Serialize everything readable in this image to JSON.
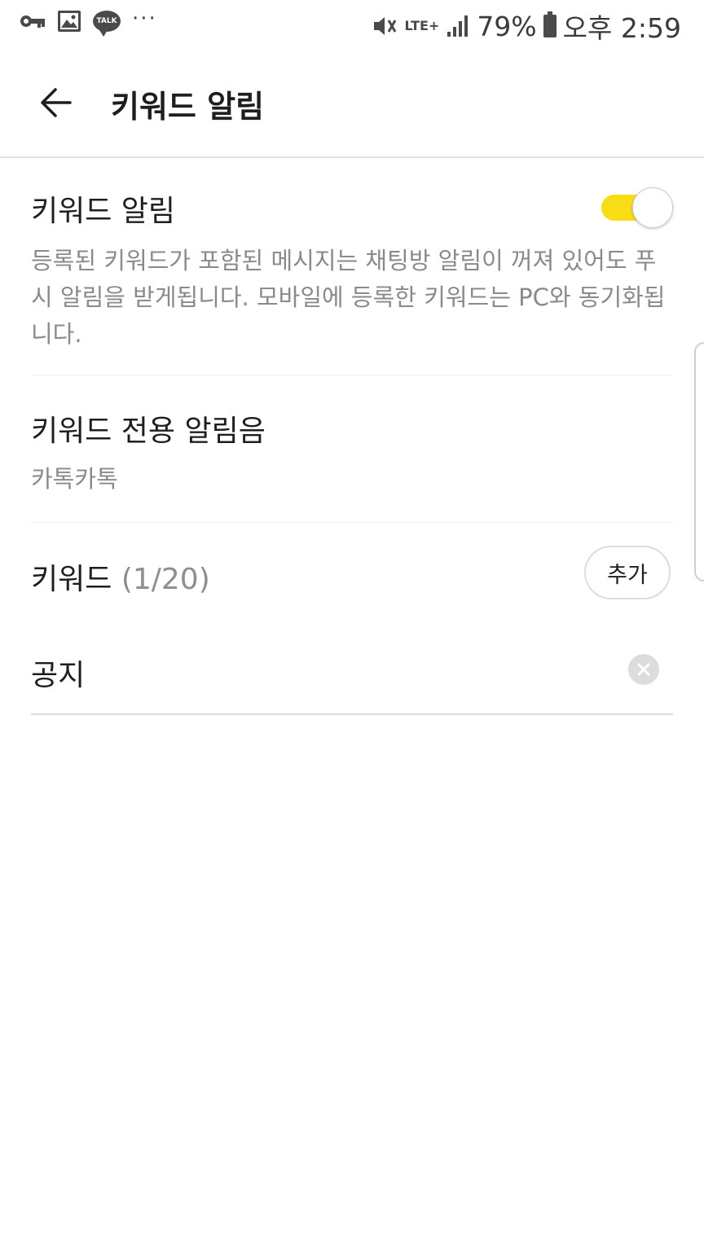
{
  "status_bar": {
    "notification_icons": [
      "key-icon",
      "image-icon",
      "kakaotalk-icon",
      "more-notifications-icon"
    ],
    "talk_label": "TALK",
    "more": "···",
    "network_label": "LTE+",
    "battery": "79%",
    "time": "오후 2:59"
  },
  "app_bar": {
    "title": "키워드 알림"
  },
  "keyword_alert": {
    "title": "키워드 알림",
    "toggle_on": true,
    "description": "등록된 키워드가 포함된 메시지는 채팅방 알림이 꺼져 있어도 푸시 알림을 받게됩니다. 모바일에 등록한 키워드는 PC와 동기화됩니다."
  },
  "alert_sound": {
    "title": "키워드 전용 알림음",
    "value": "카톡카톡"
  },
  "keywords": {
    "title": "키워드",
    "count": "(1/20)",
    "add_label": "추가",
    "items": [
      {
        "label": "공지"
      }
    ]
  },
  "colors": {
    "accent": "#f8dd16",
    "text_primary": "#1e1e1e",
    "text_secondary": "#8a8a8a"
  }
}
